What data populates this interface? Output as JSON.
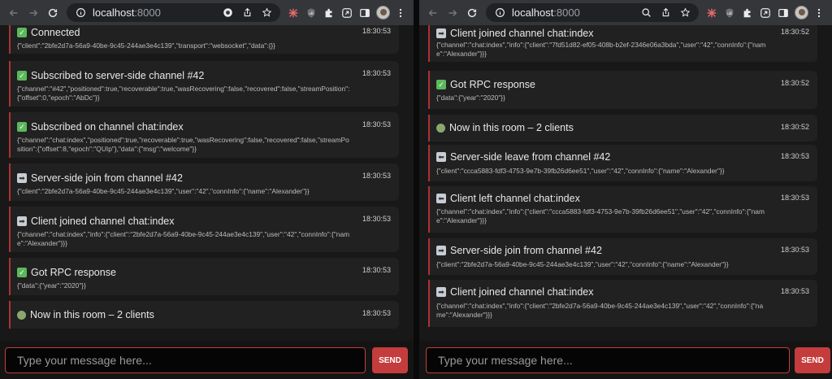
{
  "left": {
    "url_host": "localhost",
    "url_port": ":8000",
    "messages": [
      {
        "icon": "check",
        "title": "Connected",
        "time": "18:30:53",
        "data": "{\"client\":\"2bfe2d7a-56a9-40be-9c45-244ae3e4c139\",\"transport\":\"websocket\",\"data\":{}}"
      },
      {
        "icon": "check",
        "title": "Subscribed to server-side channel #42",
        "time": "18:30:53",
        "data": "{\"channel\":\"#42\",\"positioned\":true,\"recoverable\":true,\"wasRecovering\":false,\"recovered\":false,\"streamPosition\":{\"offset\":0,\"epoch\":\"AbDc\"}}"
      },
      {
        "icon": "check",
        "title": "Subscribed on channel chat:index",
        "time": "18:30:53",
        "data": "{\"channel\":\"chat:index\",\"positioned\":true,\"recoverable\":true,\"wasRecovering\":false,\"recovered\":false,\"streamPosition\":{\"offset\":8,\"epoch\":\"QUIp\"},\"data\":{\"msg\":\"welcome\"}}"
      },
      {
        "icon": "arrow-in",
        "title": "Server-side join from channel #42",
        "time": "18:30:53",
        "data": "{\"client\":\"2bfe2d7a-56a9-40be-9c45-244ae3e4c139\",\"user\":\"42\",\"connInfo\":{\"name\":\"Alexander\"}}"
      },
      {
        "icon": "arrow-in",
        "title": "Client joined channel chat:index",
        "time": "18:30:53",
        "data": "{\"channel\":\"chat:index\",\"info\":{\"client\":\"2bfe2d7a-56a9-40be-9c45-244ae3e4c139\",\"user\":\"42\",\"connInfo\":{\"name\":\"Alexander\"}}}"
      },
      {
        "icon": "check",
        "title": "Got RPC response",
        "time": "18:30:53",
        "data": "{\"data\":{\"year\":\"2020\"}}"
      },
      {
        "icon": "room",
        "title": "Now in this room – 2 clients",
        "time": "18:30:53",
        "data": ""
      }
    ],
    "input_placeholder": "Type your message here...",
    "send_label": "SEND"
  },
  "right": {
    "url_host": "localhost",
    "url_port": ":8000",
    "messages": [
      {
        "icon": "arrow-in",
        "title": "Client joined channel chat:index",
        "time": "18:30:52",
        "data": "{\"channel\":\"chat:index\",\"info\":{\"client\":\"7fd51d82-ef05-408b-b2ef-2346e06a3bda\",\"user\":\"42\",\"connInfo\":{\"name\":\"Alexander\"}}}"
      },
      {
        "icon": "check",
        "title": "Got RPC response",
        "time": "18:30:52",
        "data": "{\"data\":{\"year\":\"2020\"}}"
      },
      {
        "icon": "room",
        "title": "Now in this room – 2 clients",
        "time": "18:30:52",
        "data": ""
      },
      {
        "icon": "arrow-out",
        "title": "Server-side leave from channel #42",
        "time": "18:30:53",
        "data": "{\"client\":\"ccca5883-fdf3-4753-9e7b-39fb26d6ee51\",\"user\":\"42\",\"connInfo\":{\"name\":\"Alexander\"}}"
      },
      {
        "icon": "arrow-out",
        "title": "Client left channel chat:index",
        "time": "18:30:53",
        "data": "{\"channel\":\"chat:index\",\"info\":{\"client\":\"ccca5883-fdf3-4753-9e7b-39fb26d6ee51\",\"user\":\"42\",\"connInfo\":{\"name\":\"Alexander\"}}}"
      },
      {
        "icon": "arrow-in",
        "title": "Server-side join from channel #42",
        "time": "18:30:53",
        "data": "{\"client\":\"2bfe2d7a-56a9-40be-9c45-244ae3e4c139\",\"user\":\"42\",\"connInfo\":{\"name\":\"Alexander\"}}"
      },
      {
        "icon": "arrow-in",
        "title": "Client joined channel chat:index",
        "time": "18:30:53",
        "data": "{\"channel\":\"chat:index\",\"info\":{\"client\":\"2bfe2d7a-56a9-40be-9c45-244ae3e4c139\",\"user\":\"42\",\"connInfo\":{\"name\":\"Alexander\"}}}"
      }
    ],
    "input_placeholder": "Type your message here...",
    "send_label": "SEND"
  },
  "colors": {
    "accent": "#c53c3c",
    "background": "#181818",
    "card": "#212121"
  }
}
